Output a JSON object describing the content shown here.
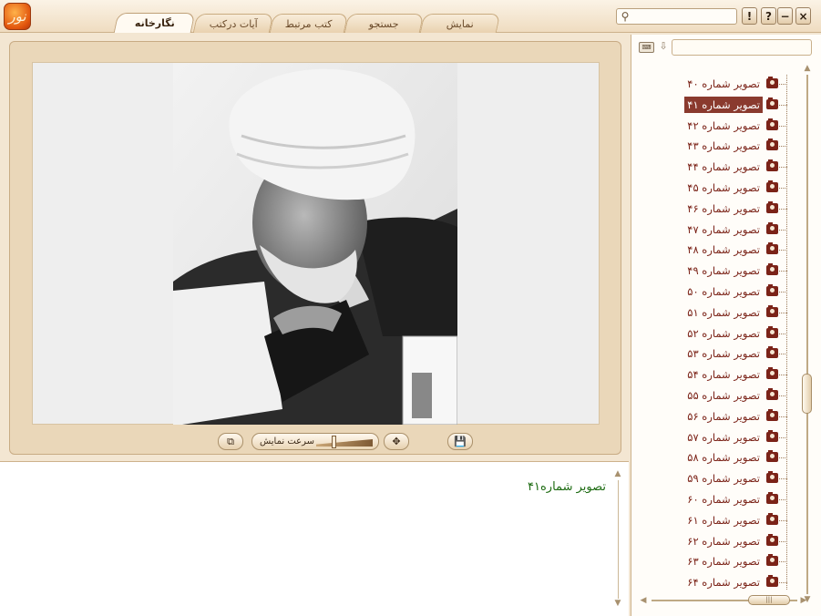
{
  "app": {
    "logo_text": "نور"
  },
  "tabs": [
    {
      "label": "نگارخانه",
      "active": true
    },
    {
      "label": "آیات درکتب",
      "active": false
    },
    {
      "label": "کتب مرتبط",
      "active": false
    },
    {
      "label": "جستجو",
      "active": false
    },
    {
      "label": "نمایش",
      "active": false
    }
  ],
  "window_buttons": {
    "help": "!",
    "about": "?",
    "minimize": "−",
    "close": "×"
  },
  "viewer": {
    "speed_label": "سرعت نمایش",
    "speed_value": 0.3
  },
  "description": {
    "text": "تصویر شماره۴۱"
  },
  "image_list": {
    "selected_index": 1,
    "items": [
      "تصویر شماره ۴۰",
      "تصویر شماره ۴۱",
      "تصویر شماره ۴۲",
      "تصویر شماره ۴۳",
      "تصویر شماره ۴۴",
      "تصویر شماره ۴۵",
      "تصویر شماره ۴۶",
      "تصویر شماره ۴۷",
      "تصویر شماره ۴۸",
      "تصویر شماره ۴۹",
      "تصویر شماره ۵۰",
      "تصویر شماره ۵۱",
      "تصویر شماره ۵۲",
      "تصویر شماره ۵۳",
      "تصویر شماره ۵۴",
      "تصویر شماره ۵۵",
      "تصویر شماره ۵۶",
      "تصویر شماره ۵۷",
      "تصویر شماره ۵۸",
      "تصویر شماره ۵۹",
      "تصویر شماره ۶۰",
      "تصویر شماره ۶۱",
      "تصویر شماره ۶۲",
      "تصویر شماره ۶۳",
      "تصویر شماره ۶۴"
    ]
  },
  "colors": {
    "accent": "#7b2318",
    "selection": "#8a3a2e",
    "description_text": "#1d6b12",
    "panel": "#ead7b9"
  }
}
